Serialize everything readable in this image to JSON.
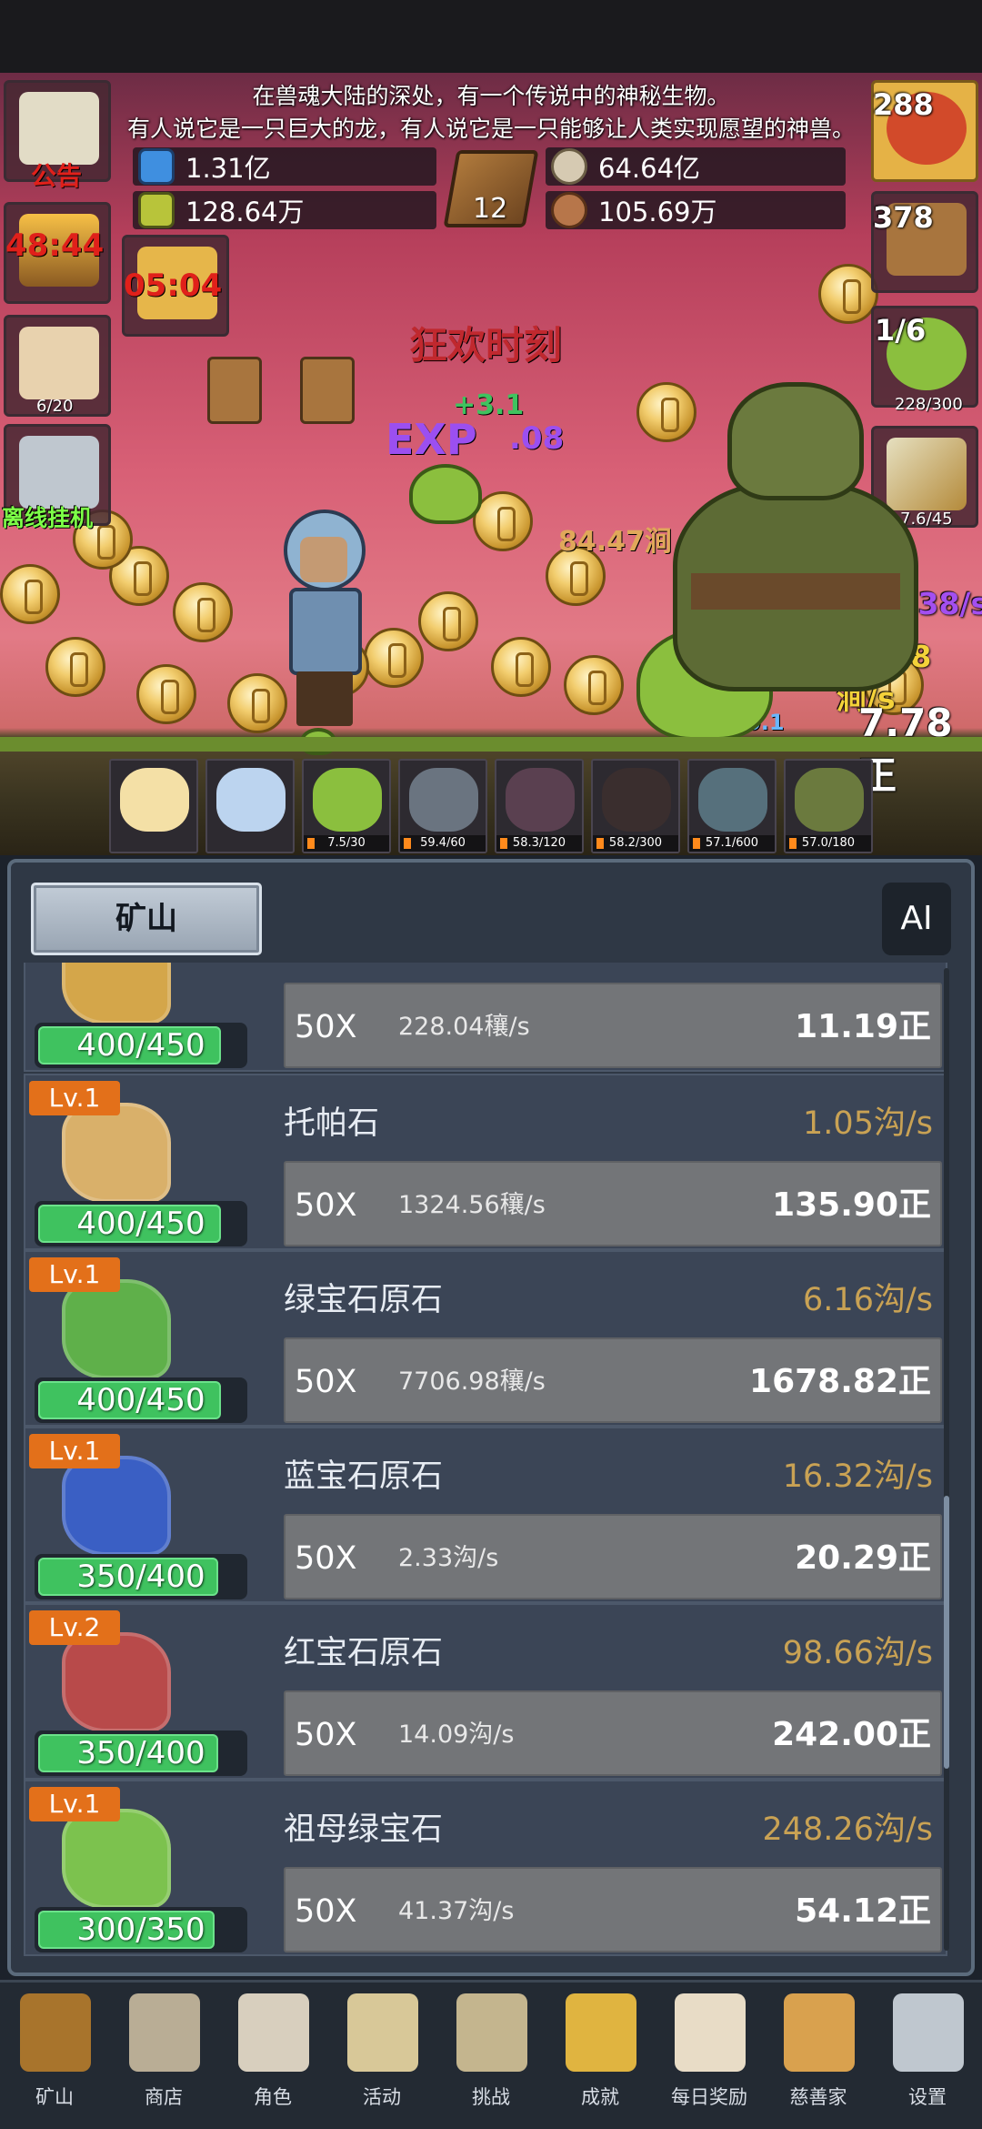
{
  "story": {
    "line1": "在兽魂大陆的深处，有一个传说中的神秘生物。",
    "line2": "有人说它是一只巨大的龙，有人说它是一只能够让人类实现愿望的神兽。"
  },
  "resources": {
    "blue_potion": "1.31亿",
    "green_potion": "128.64万",
    "shell": "64.64亿",
    "meat": "105.69万",
    "book_count": "12"
  },
  "left_side": {
    "notice_label": "公告",
    "torch_timer": "48:44",
    "holy_timer": "05:04",
    "beer_count": "6/20",
    "offline_label": "离线挂机"
  },
  "right_side": {
    "potion_count": "288",
    "chest_count": "378",
    "slime_fraction": "1/6",
    "slime_progress": "228/300",
    "sword_progress": "7.6/45",
    "rate_purple": "8.38/s",
    "rate_yellow": "59.48涧/s",
    "total": "7.78正"
  },
  "scene_text": {
    "carnival": "狂欢时刻",
    "exp": "EXP",
    "float1": "+0.1",
    "float2": "84.47涧",
    "float3": "+3.1",
    "float4": ".08"
  },
  "monsters": [
    {
      "name": "candle",
      "count": ""
    },
    {
      "name": "egg",
      "count": ""
    },
    {
      "name": "slime",
      "count": "7.5/30"
    },
    {
      "name": "ghost",
      "count": "59.4/60"
    },
    {
      "name": "imp",
      "count": "58.3/120"
    },
    {
      "name": "shade",
      "count": "58.2/300"
    },
    {
      "name": "hood",
      "count": "57.1/600"
    },
    {
      "name": "goblin",
      "count": "57.0/180"
    }
  ],
  "panel": {
    "tab_label": "矿山",
    "ai_label": "AI"
  },
  "mines": [
    {
      "level": "",
      "name": "",
      "rate": "",
      "capacity": "400/450",
      "cap_ratio": 0.89,
      "mult": "50X",
      "speed": "228.04穰/s",
      "cost": "11.19正",
      "gem_color": "#d4a64a"
    },
    {
      "level": "Lv.1",
      "name": "托帕石",
      "rate": "1.05沟/s",
      "capacity": "400/450",
      "cap_ratio": 0.89,
      "mult": "50X",
      "speed": "1324.56穰/s",
      "cost": "135.90正",
      "gem_color": "#d9b06a"
    },
    {
      "level": "Lv.1",
      "name": "绿宝石原石",
      "rate": "6.16沟/s",
      "capacity": "400/450",
      "cap_ratio": 0.89,
      "mult": "50X",
      "speed": "7706.98穰/s",
      "cost": "1678.82正",
      "gem_color": "#5fb04a"
    },
    {
      "level": "Lv.1",
      "name": "蓝宝石原石",
      "rate": "16.32沟/s",
      "capacity": "350/400",
      "cap_ratio": 0.875,
      "mult": "50X",
      "speed": "2.33沟/s",
      "cost": "20.29正",
      "gem_color": "#3a5fc4"
    },
    {
      "level": "Lv.2",
      "name": "红宝石原石",
      "rate": "98.66沟/s",
      "capacity": "350/400",
      "cap_ratio": 0.875,
      "mult": "50X",
      "speed": "14.09沟/s",
      "cost": "242.00正",
      "gem_color": "#b84a4a"
    },
    {
      "level": "Lv.1",
      "name": "祖母绿宝石",
      "rate": "248.26沟/s",
      "capacity": "300/350",
      "cap_ratio": 0.857,
      "mult": "50X",
      "speed": "41.37沟/s",
      "cost": "54.12正",
      "gem_color": "#7cc24e"
    }
  ],
  "nav": [
    {
      "label": "矿山",
      "icon": "lantern-icon"
    },
    {
      "label": "商店",
      "icon": "shop-stone-icon"
    },
    {
      "label": "角色",
      "icon": "skull-icon"
    },
    {
      "label": "活动",
      "icon": "scroll-icon"
    },
    {
      "label": "挑战",
      "icon": "map-icon"
    },
    {
      "label": "成就",
      "icon": "key-icon"
    },
    {
      "label": "每日奖励",
      "icon": "letter-icon"
    },
    {
      "label": "慈善家",
      "icon": "bread-icon"
    },
    {
      "label": "设置",
      "icon": "gear-icon"
    }
  ]
}
